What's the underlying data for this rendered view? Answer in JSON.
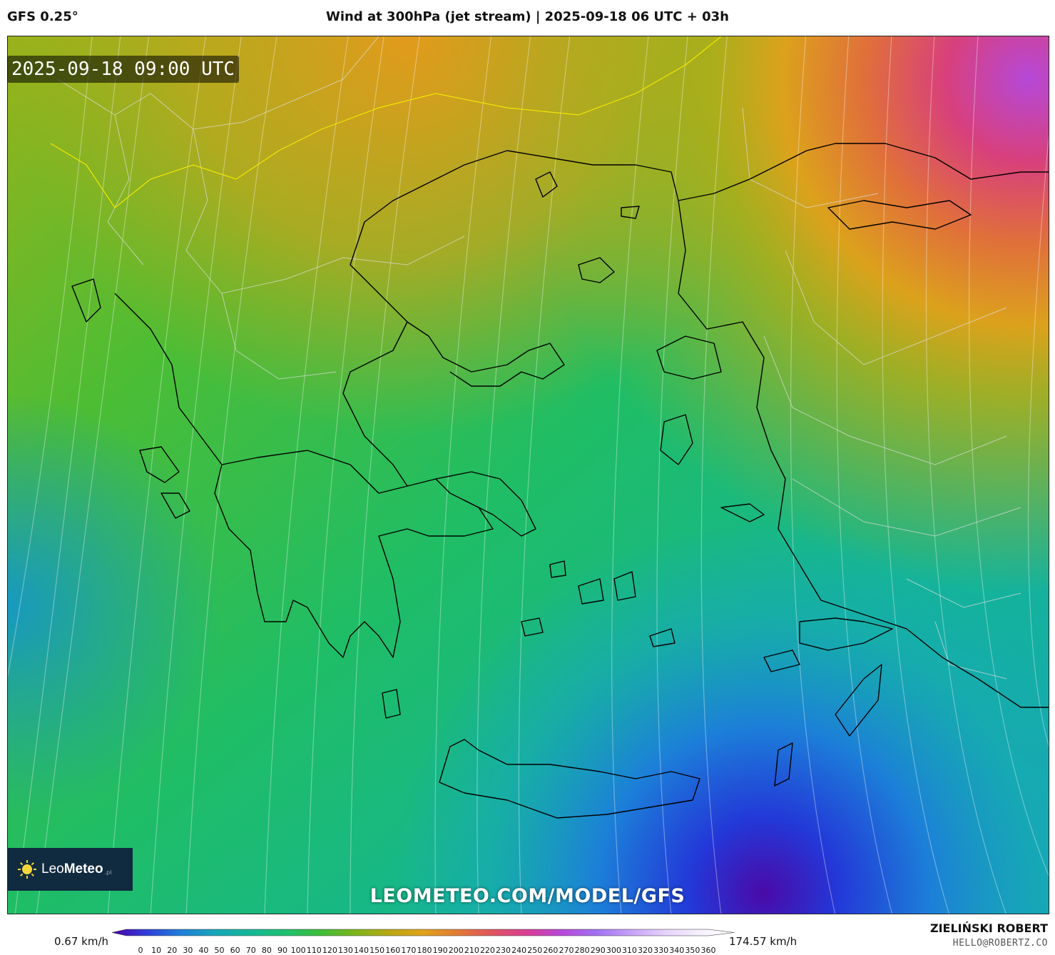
{
  "header": {
    "model": "GFS 0.25°",
    "title": "Wind at 300hPa (jet stream) | 2025-09-18 06 UTC + 03h"
  },
  "map": {
    "valid_time": "2025-09-18 09:00 UTC",
    "watermark": "LEOMETEO.COM/MODEL/GFS",
    "variable": "wind speed",
    "region": "Greece / Aegean / western Turkey"
  },
  "logo": {
    "brand_light": "Leo",
    "brand_bold": "Meteo",
    "suffix": ".pl"
  },
  "colorbar": {
    "min_label": "0.67 km/h",
    "max_label": "174.57 km/h",
    "ticks": [
      "0",
      "10",
      "20",
      "30",
      "40",
      "50",
      "60",
      "70",
      "80",
      "90",
      "100",
      "110",
      "120",
      "130",
      "140",
      "150",
      "160",
      "170",
      "180",
      "190",
      "200",
      "210",
      "220",
      "230",
      "240",
      "250",
      "260",
      "270",
      "280",
      "290",
      "300",
      "310",
      "320",
      "330",
      "340",
      "350",
      "360"
    ],
    "colors": [
      "#4b00a8",
      "#2f3fd8",
      "#1f7fd8",
      "#17a7b8",
      "#14b896",
      "#1ec070",
      "#3dbd3a",
      "#7ab51e",
      "#b7a814",
      "#e0a21a",
      "#e37a35",
      "#e05560",
      "#d83e95",
      "#b948d8",
      "#a070f0",
      "#c6a0f8",
      "#e6d2fb",
      "#f6f0fd",
      "#ffffff"
    ]
  },
  "credits": {
    "author": "ZIELIŃSKI ROBERT",
    "email": "HELLO@ROBERTZ.CO"
  }
}
